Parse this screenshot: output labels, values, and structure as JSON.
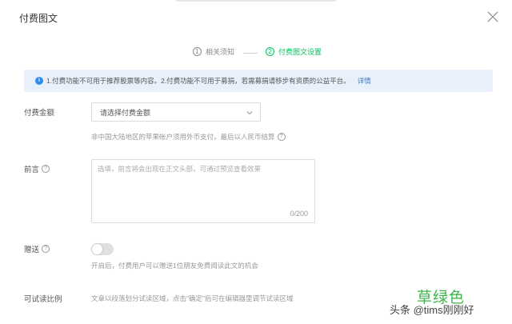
{
  "dialog": {
    "title": "付费图文",
    "close_icon": "close-icon"
  },
  "steps": {
    "step1": {
      "number": "1",
      "label": "相关须知",
      "state": "done"
    },
    "step2": {
      "number": "2",
      "label": "付费图文设置",
      "state": "active"
    }
  },
  "notice": {
    "icon": "info-icon",
    "text": "1.付费功能不可用于推荐股票等内容。2.付费功能不可用于募捐，若需募捐请移步有资质的公益平台。",
    "link": "详情"
  },
  "form": {
    "price": {
      "label": "付费金额",
      "placeholder": "请选择付费金额",
      "hint": "非中国大陆地区的苹果帐户须用外币支付，最后以人民币结算"
    },
    "preface": {
      "label": "前言",
      "placeholder": "选填，前言将会出现在正文头部，可通过预览查看效果",
      "value": "",
      "counter": "0/200"
    },
    "gift": {
      "label": "赠送",
      "enabled": false,
      "hint": "开启后，付费用户可以赠送1位朋友免费阅读此文的机会"
    },
    "trial": {
      "label": "可试读比例",
      "hint": "文章以段落划分试读区域，点击\"确定\"后可在编辑器里调节试读区域"
    }
  },
  "watermark": {
    "caption": "草绿色",
    "source": "头条 @tims刚刚好"
  },
  "colors": {
    "accent": "#07c160",
    "notice_bg": "#e7f0fb",
    "info_blue": "#2d8cf0",
    "link": "#4a7bb3",
    "watermark_green": "#3cb64a"
  }
}
